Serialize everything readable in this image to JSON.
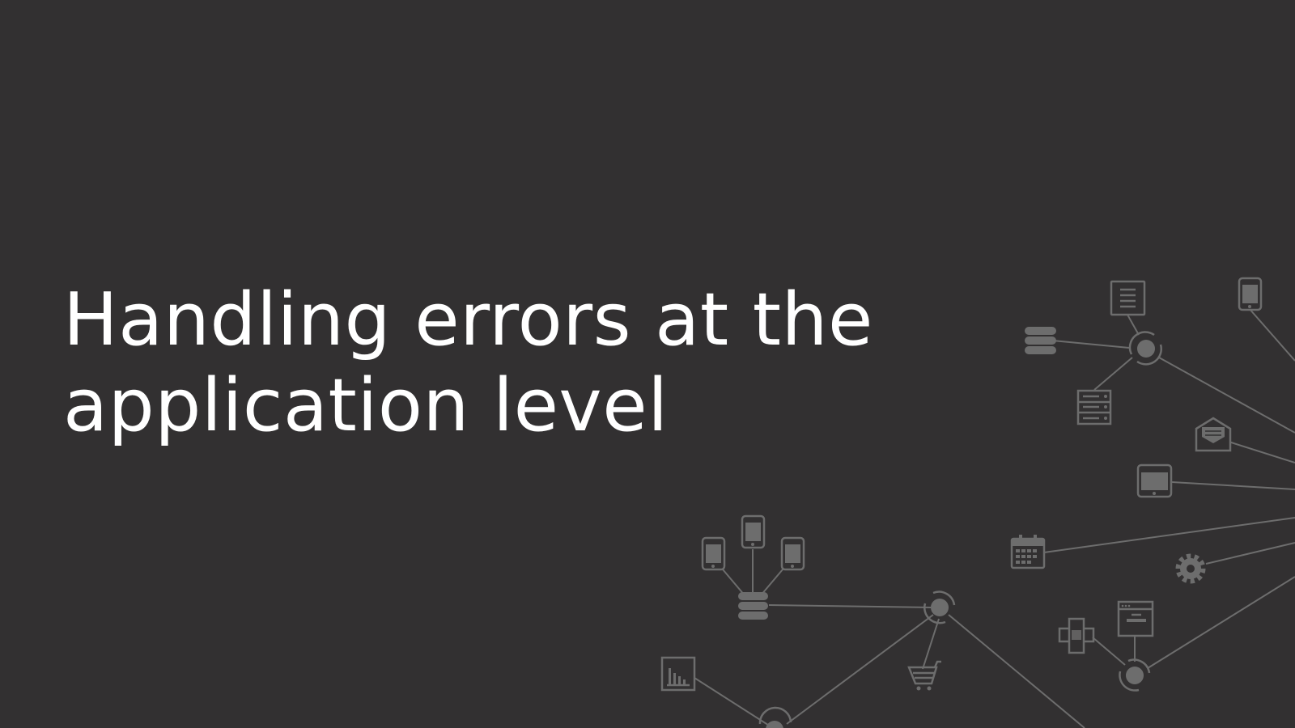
{
  "slide": {
    "title_lines": [
      "Handling errors at the",
      "application level"
    ]
  },
  "colors": {
    "background": "#323031",
    "title": "#ffffff",
    "network": "#6d6d6d"
  },
  "network_icons": [
    "document-icon",
    "database-icon",
    "server-rack-icon",
    "mobile-phone-icon",
    "mail-icon",
    "tablet-icon",
    "calendar-icon",
    "gear-icon",
    "browser-window-icon",
    "plug-connector-icon",
    "shopping-cart-icon",
    "bar-chart-icon",
    "hub-node-icon"
  ]
}
